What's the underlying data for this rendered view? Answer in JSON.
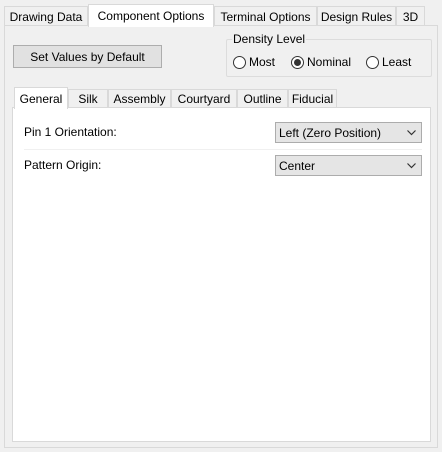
{
  "tabs": [
    {
      "label": "Drawing Data"
    },
    {
      "label": "Component Options",
      "active": true
    },
    {
      "label": "Terminal Options"
    },
    {
      "label": "Design Rules"
    },
    {
      "label": "3D"
    }
  ],
  "set_default_button": "Set Values by Default",
  "density": {
    "label": "Density Level",
    "options": [
      {
        "label": "Most",
        "checked": false
      },
      {
        "label": "Nominal",
        "checked": true
      },
      {
        "label": "Least",
        "checked": false
      }
    ]
  },
  "subtabs": [
    {
      "label": "General",
      "active": true
    },
    {
      "label": "Silk"
    },
    {
      "label": "Assembly"
    },
    {
      "label": "Courtyard"
    },
    {
      "label": "Outline"
    },
    {
      "label": "Fiducial"
    }
  ],
  "general": {
    "pin1": {
      "label": "Pin 1 Orientation:",
      "value": "Left (Zero Position)"
    },
    "origin": {
      "label": "Pattern Origin:",
      "value": "Center"
    }
  },
  "icons": {
    "dropdown": "chevron-down-icon"
  }
}
